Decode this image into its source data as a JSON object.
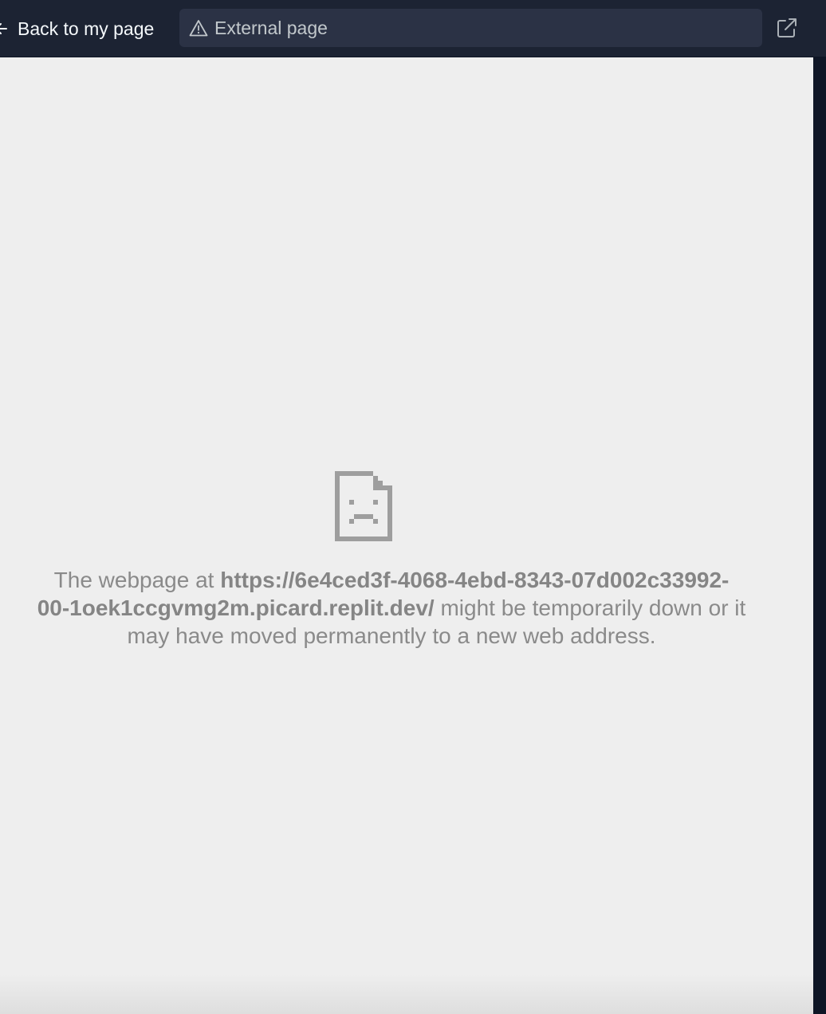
{
  "topbar": {
    "back_label": "Back to my page",
    "url_label": "External page",
    "icons": {
      "back": "arrow-left-icon",
      "warning": "warning-triangle-icon",
      "open_external": "external-link-icon"
    }
  },
  "error_page": {
    "icon": "sad-document-icon",
    "prefix": "The webpage at ",
    "url_line1": "https://6e4ced3f-4068-4ebd-8343-07d002c33992-",
    "url_line2": "00-1oek1ccgvmg2m.picard.replit.dev/",
    "suffix_line2": " might be temporarily down or it",
    "line3": "may have moved permanently to a new web address."
  },
  "colors": {
    "topbar_bg": "#1c2333",
    "urlbar_bg": "#2b3245",
    "page_bg": "#eeeeee",
    "error_text": "#8a8a8a"
  }
}
